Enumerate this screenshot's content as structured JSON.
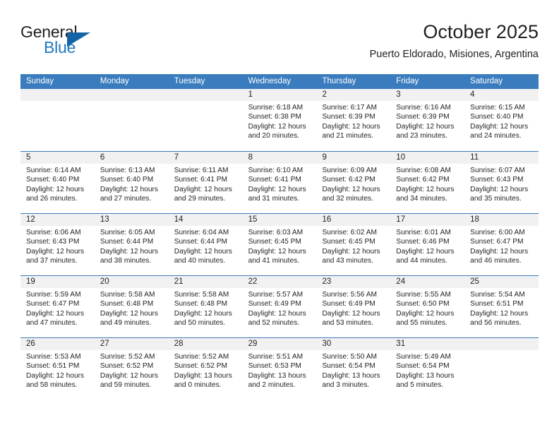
{
  "brand": {
    "name_top": "General",
    "name_bottom": "Blue",
    "accent_color": "#1464a5",
    "text_color": "#231f20"
  },
  "header": {
    "title": "October 2025",
    "subtitle": "Puerto Eldorado, Misiones, Argentina"
  },
  "calendar": {
    "header_bg": "#3a7cbd",
    "daynum_bg": "#f1f1f1",
    "weekdays": [
      "Sunday",
      "Monday",
      "Tuesday",
      "Wednesday",
      "Thursday",
      "Friday",
      "Saturday"
    ],
    "weeks": [
      [
        {
          "day": "",
          "lines": []
        },
        {
          "day": "",
          "lines": []
        },
        {
          "day": "",
          "lines": []
        },
        {
          "day": "1",
          "lines": [
            "Sunrise: 6:18 AM",
            "Sunset: 6:38 PM",
            "Daylight: 12 hours",
            "and 20 minutes."
          ]
        },
        {
          "day": "2",
          "lines": [
            "Sunrise: 6:17 AM",
            "Sunset: 6:39 PM",
            "Daylight: 12 hours",
            "and 21 minutes."
          ]
        },
        {
          "day": "3",
          "lines": [
            "Sunrise: 6:16 AM",
            "Sunset: 6:39 PM",
            "Daylight: 12 hours",
            "and 23 minutes."
          ]
        },
        {
          "day": "4",
          "lines": [
            "Sunrise: 6:15 AM",
            "Sunset: 6:40 PM",
            "Daylight: 12 hours",
            "and 24 minutes."
          ]
        }
      ],
      [
        {
          "day": "5",
          "lines": [
            "Sunrise: 6:14 AM",
            "Sunset: 6:40 PM",
            "Daylight: 12 hours",
            "and 26 minutes."
          ]
        },
        {
          "day": "6",
          "lines": [
            "Sunrise: 6:13 AM",
            "Sunset: 6:40 PM",
            "Daylight: 12 hours",
            "and 27 minutes."
          ]
        },
        {
          "day": "7",
          "lines": [
            "Sunrise: 6:11 AM",
            "Sunset: 6:41 PM",
            "Daylight: 12 hours",
            "and 29 minutes."
          ]
        },
        {
          "day": "8",
          "lines": [
            "Sunrise: 6:10 AM",
            "Sunset: 6:41 PM",
            "Daylight: 12 hours",
            "and 31 minutes."
          ]
        },
        {
          "day": "9",
          "lines": [
            "Sunrise: 6:09 AM",
            "Sunset: 6:42 PM",
            "Daylight: 12 hours",
            "and 32 minutes."
          ]
        },
        {
          "day": "10",
          "lines": [
            "Sunrise: 6:08 AM",
            "Sunset: 6:42 PM",
            "Daylight: 12 hours",
            "and 34 minutes."
          ]
        },
        {
          "day": "11",
          "lines": [
            "Sunrise: 6:07 AM",
            "Sunset: 6:43 PM",
            "Daylight: 12 hours",
            "and 35 minutes."
          ]
        }
      ],
      [
        {
          "day": "12",
          "lines": [
            "Sunrise: 6:06 AM",
            "Sunset: 6:43 PM",
            "Daylight: 12 hours",
            "and 37 minutes."
          ]
        },
        {
          "day": "13",
          "lines": [
            "Sunrise: 6:05 AM",
            "Sunset: 6:44 PM",
            "Daylight: 12 hours",
            "and 38 minutes."
          ]
        },
        {
          "day": "14",
          "lines": [
            "Sunrise: 6:04 AM",
            "Sunset: 6:44 PM",
            "Daylight: 12 hours",
            "and 40 minutes."
          ]
        },
        {
          "day": "15",
          "lines": [
            "Sunrise: 6:03 AM",
            "Sunset: 6:45 PM",
            "Daylight: 12 hours",
            "and 41 minutes."
          ]
        },
        {
          "day": "16",
          "lines": [
            "Sunrise: 6:02 AM",
            "Sunset: 6:45 PM",
            "Daylight: 12 hours",
            "and 43 minutes."
          ]
        },
        {
          "day": "17",
          "lines": [
            "Sunrise: 6:01 AM",
            "Sunset: 6:46 PM",
            "Daylight: 12 hours",
            "and 44 minutes."
          ]
        },
        {
          "day": "18",
          "lines": [
            "Sunrise: 6:00 AM",
            "Sunset: 6:47 PM",
            "Daylight: 12 hours",
            "and 46 minutes."
          ]
        }
      ],
      [
        {
          "day": "19",
          "lines": [
            "Sunrise: 5:59 AM",
            "Sunset: 6:47 PM",
            "Daylight: 12 hours",
            "and 47 minutes."
          ]
        },
        {
          "day": "20",
          "lines": [
            "Sunrise: 5:58 AM",
            "Sunset: 6:48 PM",
            "Daylight: 12 hours",
            "and 49 minutes."
          ]
        },
        {
          "day": "21",
          "lines": [
            "Sunrise: 5:58 AM",
            "Sunset: 6:48 PM",
            "Daylight: 12 hours",
            "and 50 minutes."
          ]
        },
        {
          "day": "22",
          "lines": [
            "Sunrise: 5:57 AM",
            "Sunset: 6:49 PM",
            "Daylight: 12 hours",
            "and 52 minutes."
          ]
        },
        {
          "day": "23",
          "lines": [
            "Sunrise: 5:56 AM",
            "Sunset: 6:49 PM",
            "Daylight: 12 hours",
            "and 53 minutes."
          ]
        },
        {
          "day": "24",
          "lines": [
            "Sunrise: 5:55 AM",
            "Sunset: 6:50 PM",
            "Daylight: 12 hours",
            "and 55 minutes."
          ]
        },
        {
          "day": "25",
          "lines": [
            "Sunrise: 5:54 AM",
            "Sunset: 6:51 PM",
            "Daylight: 12 hours",
            "and 56 minutes."
          ]
        }
      ],
      [
        {
          "day": "26",
          "lines": [
            "Sunrise: 5:53 AM",
            "Sunset: 6:51 PM",
            "Daylight: 12 hours",
            "and 58 minutes."
          ]
        },
        {
          "day": "27",
          "lines": [
            "Sunrise: 5:52 AM",
            "Sunset: 6:52 PM",
            "Daylight: 12 hours",
            "and 59 minutes."
          ]
        },
        {
          "day": "28",
          "lines": [
            "Sunrise: 5:52 AM",
            "Sunset: 6:52 PM",
            "Daylight: 13 hours",
            "and 0 minutes."
          ]
        },
        {
          "day": "29",
          "lines": [
            "Sunrise: 5:51 AM",
            "Sunset: 6:53 PM",
            "Daylight: 13 hours",
            "and 2 minutes."
          ]
        },
        {
          "day": "30",
          "lines": [
            "Sunrise: 5:50 AM",
            "Sunset: 6:54 PM",
            "Daylight: 13 hours",
            "and 3 minutes."
          ]
        },
        {
          "day": "31",
          "lines": [
            "Sunrise: 5:49 AM",
            "Sunset: 6:54 PM",
            "Daylight: 13 hours",
            "and 5 minutes."
          ]
        },
        {
          "day": "",
          "lines": []
        }
      ]
    ]
  }
}
